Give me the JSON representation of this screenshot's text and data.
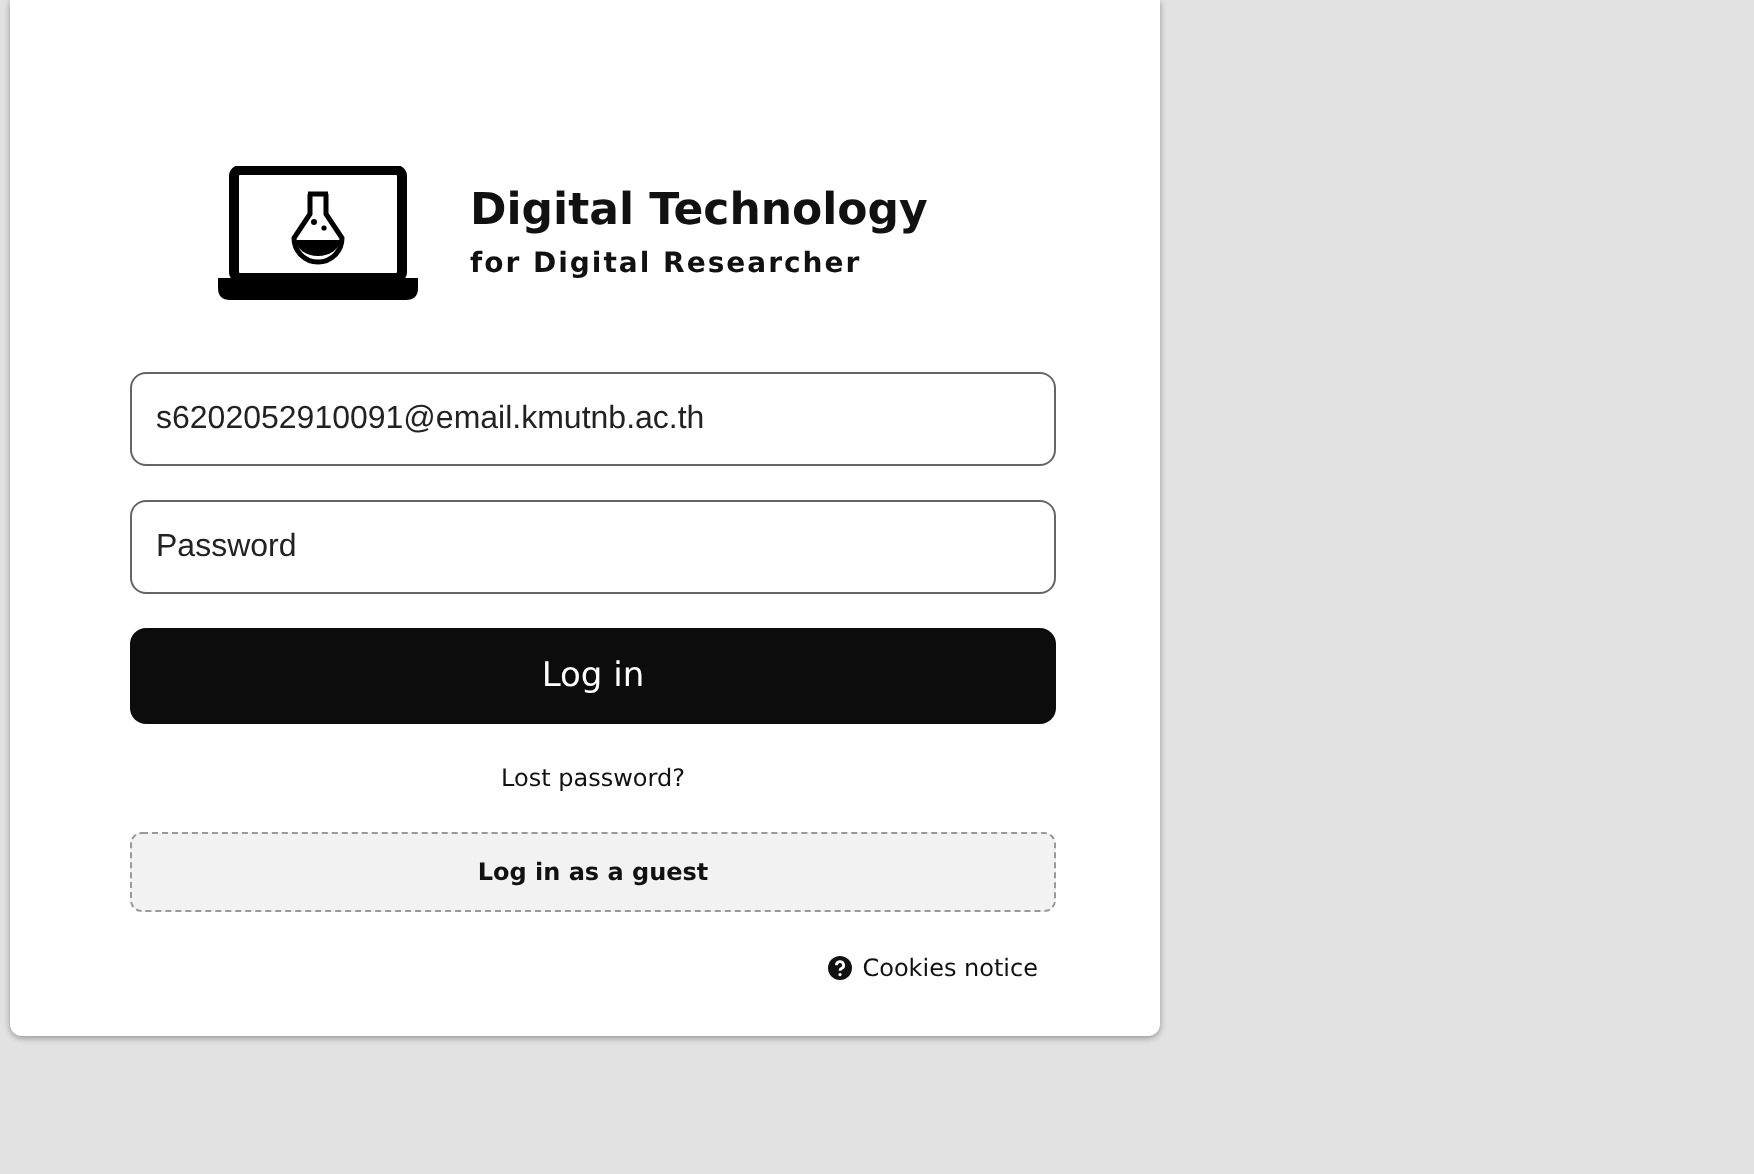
{
  "logo": {
    "title": "Digital Technology",
    "subtitle": "for Digital Researcher"
  },
  "username": {
    "value": "s6202052910091@email.kmutnb.ac.th"
  },
  "password": {
    "placeholder": "Password"
  },
  "login_button": "Log in",
  "lost_password": "Lost password?",
  "guest_button": "Log in as a guest",
  "cookies_notice": "Cookies notice"
}
